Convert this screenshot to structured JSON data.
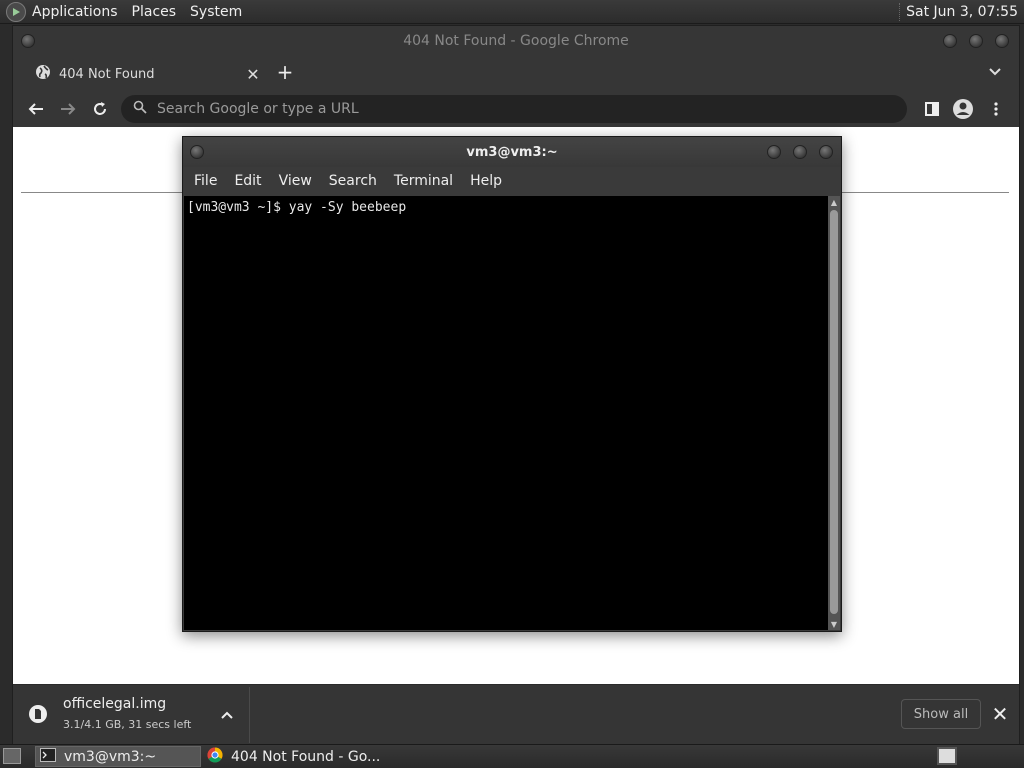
{
  "top_panel": {
    "menus": [
      "Applications",
      "Places",
      "System"
    ],
    "clock": "Sat Jun  3, 07:55"
  },
  "chrome": {
    "window_title": "404 Not Found - Google Chrome",
    "tab": {
      "title": "404 Not Found",
      "icon": "globe-icon"
    },
    "omnibox": {
      "placeholder": "Search Google or type a URL",
      "value": ""
    },
    "download": {
      "filename": "officelegal.img",
      "status": "3.1/4.1 GB, 31 secs left"
    },
    "show_all_label": "Show all"
  },
  "terminal": {
    "title": "vm3@vm3:~",
    "menus": [
      "File",
      "Edit",
      "View",
      "Search",
      "Terminal",
      "Help"
    ],
    "lines": [
      "[vm3@vm3 ~]$ yay -Sy beebeep"
    ]
  },
  "taskbar": {
    "tasks": [
      {
        "label": "vm3@vm3:~",
        "icon": "terminal-icon",
        "active": true
      },
      {
        "label": "404 Not Found - Go...",
        "icon": "chrome-icon",
        "active": false
      }
    ]
  },
  "colors": {
    "panel": "#2c2c2c",
    "chrome_frame": "#363636",
    "terminal_bg": "#000000",
    "page_bg": "#ffffff"
  }
}
